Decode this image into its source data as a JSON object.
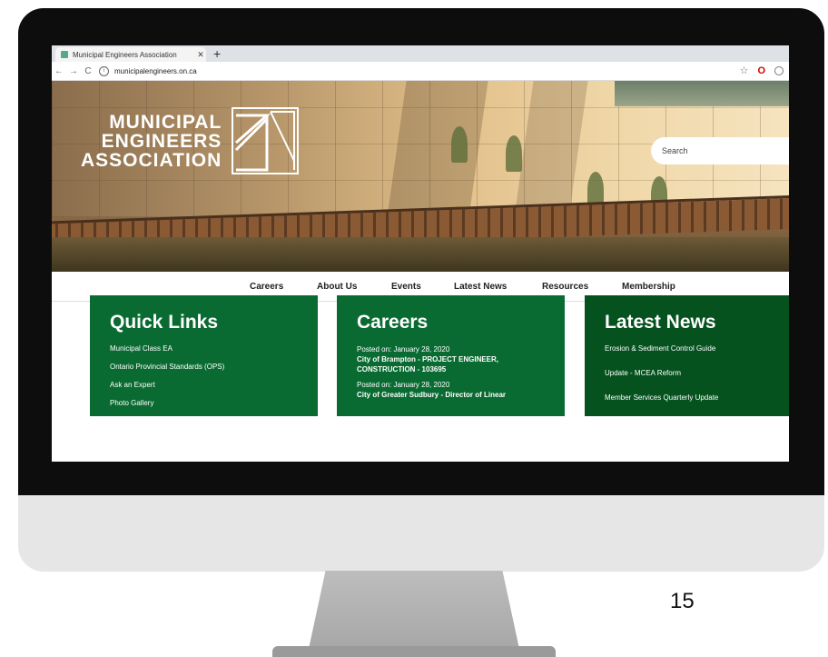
{
  "browser": {
    "tab_title": "Municipal Engineers Association",
    "tab_close": "✕",
    "new_tab": "+",
    "back": "←",
    "forward": "→",
    "reload": "C",
    "url": "municipalengineers.on.ca"
  },
  "hero": {
    "logo_lines": [
      "MUNICIPAL",
      "ENGINEERS",
      "ASSOCIATION"
    ],
    "search_placeholder": "Search"
  },
  "nav": {
    "items": [
      "Careers",
      "About Us",
      "Events",
      "Latest News",
      "Resources",
      "Membership"
    ]
  },
  "quick_links": {
    "title": "Quick Links",
    "items": [
      "Municipal Class EA",
      "Ontario Provincial Standards (OPS)",
      "Ask an Expert",
      "Photo Gallery"
    ]
  },
  "careers": {
    "title": "Careers",
    "jobs": [
      {
        "posted": "Posted on: January 28, 2020",
        "title": "City of Brampton - PROJECT ENGINEER, CONSTRUCTION - 103695"
      },
      {
        "posted": "Posted on: January 28, 2020",
        "title": "City of Greater Sudbury - Director of Linear"
      }
    ]
  },
  "latest_news": {
    "title": "Latest News",
    "items": [
      "Erosion & Sediment Control Guide",
      "Update - MCEA Reform",
      "Member Services Quarterly Update"
    ]
  },
  "slide": {
    "page_number": "15"
  },
  "colors": {
    "green": "#0a6b32",
    "dark_green": "#05521f"
  }
}
